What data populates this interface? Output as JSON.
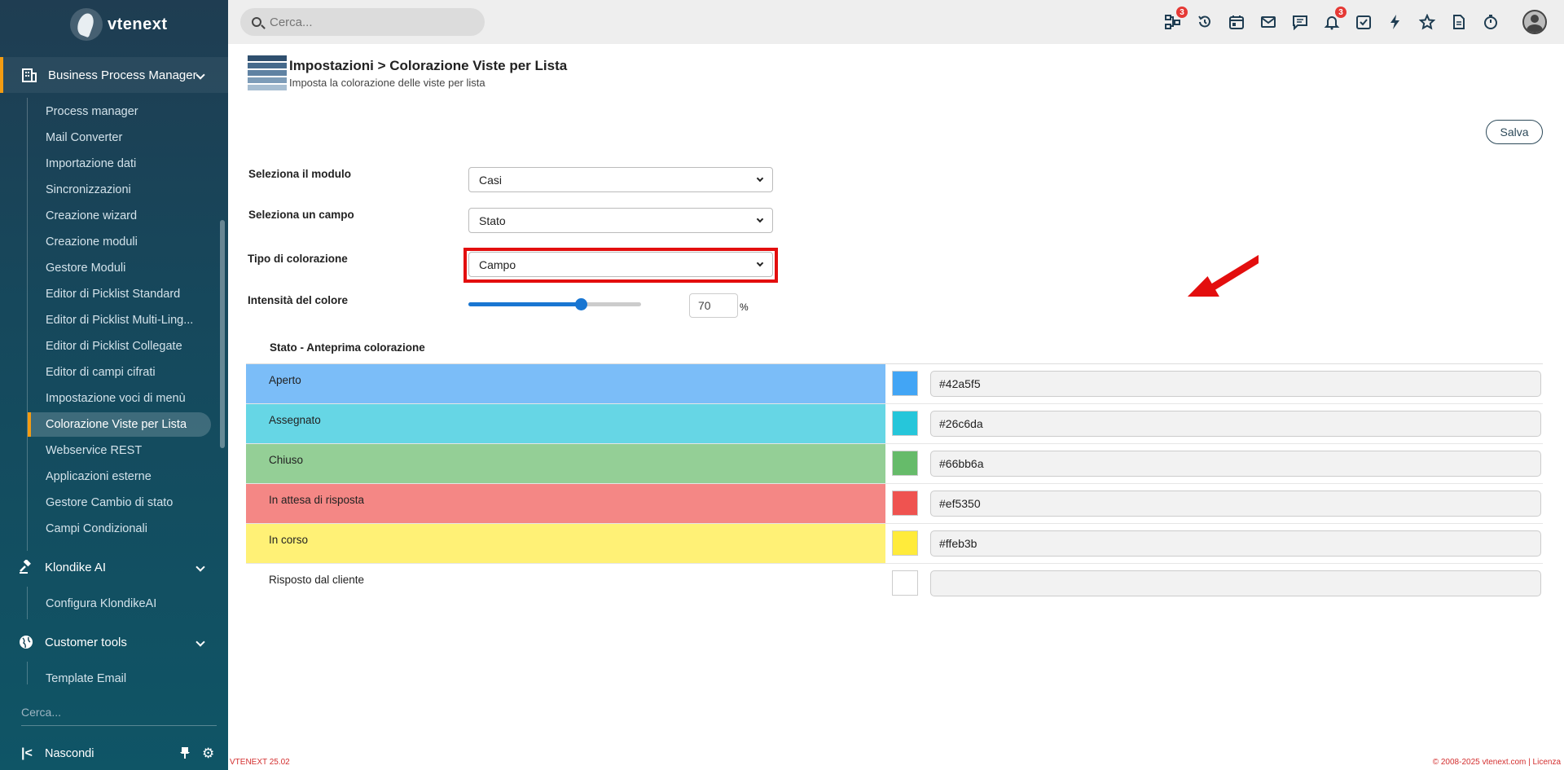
{
  "brand": {
    "logo_text": "vtenext"
  },
  "sidebar": {
    "bpm": {
      "label": "Business Process Manager"
    },
    "items": [
      {
        "label": "Process manager"
      },
      {
        "label": "Mail Converter"
      },
      {
        "label": "Importazione dati"
      },
      {
        "label": "Sincronizzazioni"
      },
      {
        "label": "Creazione wizard"
      },
      {
        "label": "Creazione moduli"
      },
      {
        "label": "Gestore Moduli"
      },
      {
        "label": "Editor di Picklist Standard"
      },
      {
        "label": "Editor di Picklist Multi-Ling..."
      },
      {
        "label": "Editor di Picklist Collegate"
      },
      {
        "label": "Editor di campi cifrati"
      },
      {
        "label": "Impostazione voci di menù"
      },
      {
        "label": "Colorazione Viste per Lista"
      },
      {
        "label": "Webservice REST"
      },
      {
        "label": "Applicazioni esterne"
      },
      {
        "label": "Gestore Cambio di stato"
      },
      {
        "label": "Campi Condizionali"
      }
    ],
    "klondike": {
      "label": "Klondike AI",
      "items": [
        {
          "label": "Configura KlondikeAI"
        }
      ]
    },
    "customer": {
      "label": "Customer tools",
      "items": [
        {
          "label": "Template Email"
        }
      ]
    },
    "search_placeholder": "Cerca...",
    "hide_label": "Nascondi"
  },
  "topbar": {
    "search_placeholder": "Cerca...",
    "icons": [
      {
        "name": "process-icon",
        "badge": "3"
      },
      {
        "name": "history-icon"
      },
      {
        "name": "calendar-icon"
      },
      {
        "name": "mail-icon"
      },
      {
        "name": "chat-icon"
      },
      {
        "name": "bell-icon",
        "badge": "3"
      },
      {
        "name": "tasks-icon"
      },
      {
        "name": "lightning-icon"
      },
      {
        "name": "star-icon"
      },
      {
        "name": "document-icon"
      },
      {
        "name": "timer-icon"
      }
    ]
  },
  "page": {
    "title": "Impostazioni > Colorazione Viste per Lista",
    "subtitle": "Imposta la colorazione delle viste per lista",
    "save_label": "Salva"
  },
  "form": {
    "module": {
      "label": "Seleziona il modulo",
      "value": "Casi"
    },
    "field": {
      "label": "Seleziona un campo",
      "value": "Stato"
    },
    "coloring_type": {
      "label": "Tipo di colorazione",
      "value": "Campo"
    },
    "intensity": {
      "label": "Intensità del colore",
      "value": "70",
      "unit": "%",
      "level_percent": 65
    }
  },
  "preview": {
    "header": "Stato - Anteprima colorazione",
    "rows": [
      {
        "name": "Aperto",
        "hex": "#42a5f5",
        "bg": "#7bbdf8",
        "swatch": "#42a5f5"
      },
      {
        "name": "Assegnato",
        "hex": "#26c6da",
        "bg": "#66d6e5",
        "swatch": "#26c6da"
      },
      {
        "name": "Chiuso",
        "hex": "#66bb6a",
        "bg": "#94cf96",
        "swatch": "#66bb6a"
      },
      {
        "name": "In attesa di risposta",
        "hex": "#ef5350",
        "bg": "#f48785",
        "swatch": "#ef5350"
      },
      {
        "name": "In corso",
        "hex": "#ffeb3b",
        "bg": "#fff176",
        "swatch": "#ffeb3b"
      },
      {
        "name": "Risposto dal cliente",
        "hex": "",
        "bg": "#ffffff",
        "swatch": "#ffffff"
      }
    ]
  },
  "footer": {
    "version": "VTENEXT 25.02",
    "copyright": "© 2008-2025 vtenext.com | ",
    "license": "Licenza"
  },
  "colors": {
    "accent": "#f39c12",
    "annotation": "#e30e0e",
    "slider": "#1976d2"
  }
}
